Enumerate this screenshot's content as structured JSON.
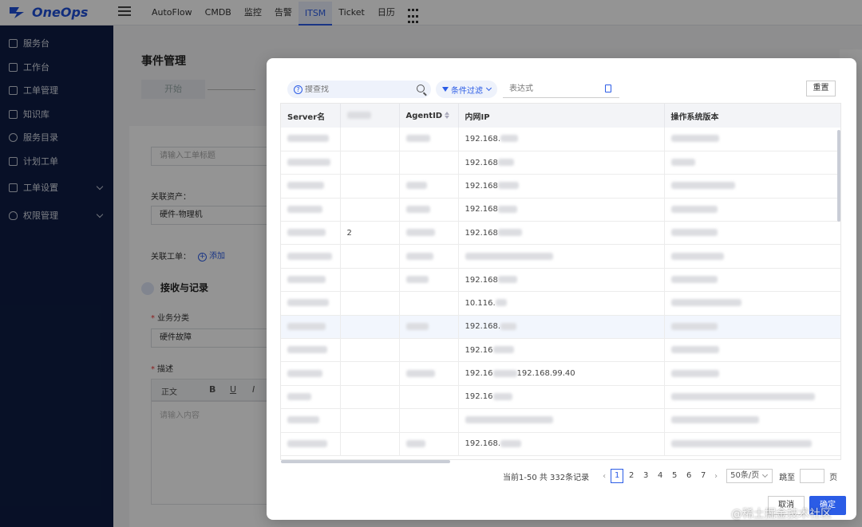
{
  "app": {
    "name": "OneOps"
  },
  "topnav": {
    "items": [
      "AutoFlow",
      "CMDB",
      "监控",
      "告警",
      "ITSM",
      "Ticket",
      "日历"
    ],
    "active": "ITSM"
  },
  "sidebar": {
    "items": [
      {
        "label": "服务台"
      },
      {
        "label": "工作台"
      },
      {
        "label": "工单管理"
      },
      {
        "label": "知识库"
      },
      {
        "label": "服务目录"
      },
      {
        "label": "计划工单"
      },
      {
        "label": "工单设置"
      },
      {
        "label": "权限管理"
      }
    ]
  },
  "page": {
    "title": "事件管理",
    "step_label": "开始",
    "title_placeholder": "请输入工单标题",
    "asset_label": "关联资产：",
    "asset_value": "硬件-物理机",
    "ticket_label": "关联工单：",
    "add_label": "添加",
    "section_title": "接收与记录",
    "category_label": "业务分类",
    "category_value": "硬件故障",
    "desc_label": "描述",
    "editor_style": "正文",
    "editor_placeholder": "请输入内容"
  },
  "modal": {
    "search_placeholder": "搜查找",
    "filter_label": "条件过滤",
    "expr_placeholder": "表达式",
    "reset_label": "重置",
    "columns": [
      "Server名",
      "",
      "AgentID",
      "内网IP",
      "操作系统版本"
    ],
    "rows": [
      {
        "c2": "",
        "ip": "192.168."
      },
      {
        "c2": "",
        "ip": "192.168"
      },
      {
        "c2": "",
        "ip": "192.168"
      },
      {
        "c2": "",
        "ip": "192.168"
      },
      {
        "c2": "2",
        "ip": "192.168"
      },
      {
        "c2": "",
        "ip": ""
      },
      {
        "c2": "",
        "ip": "192.168"
      },
      {
        "c2": "",
        "ip": "10.116."
      },
      {
        "c2": "",
        "ip": "192.168."
      },
      {
        "c2": "",
        "ip": "192.16"
      },
      {
        "c2": "",
        "ip": "192.16",
        "ip_extra": "192.168.99.40"
      },
      {
        "c2": "",
        "ip": "192.16"
      },
      {
        "c2": "",
        "ip": ""
      },
      {
        "c2": "",
        "ip": "192.168."
      }
    ],
    "pagination": {
      "summary": "当前1-50 共 332条记录",
      "pages": [
        "1",
        "2",
        "3",
        "4",
        "5",
        "6",
        "7"
      ],
      "current": "1",
      "page_size": "50条/页",
      "jump_label": "跳至",
      "page_unit": "页"
    },
    "cancel_label": "取消",
    "ok_label": "确定"
  },
  "watermark": "@稀土掘金技术社区",
  "colors": {
    "brand": "#2b5ce6",
    "sidebar": "#0e1d44"
  }
}
